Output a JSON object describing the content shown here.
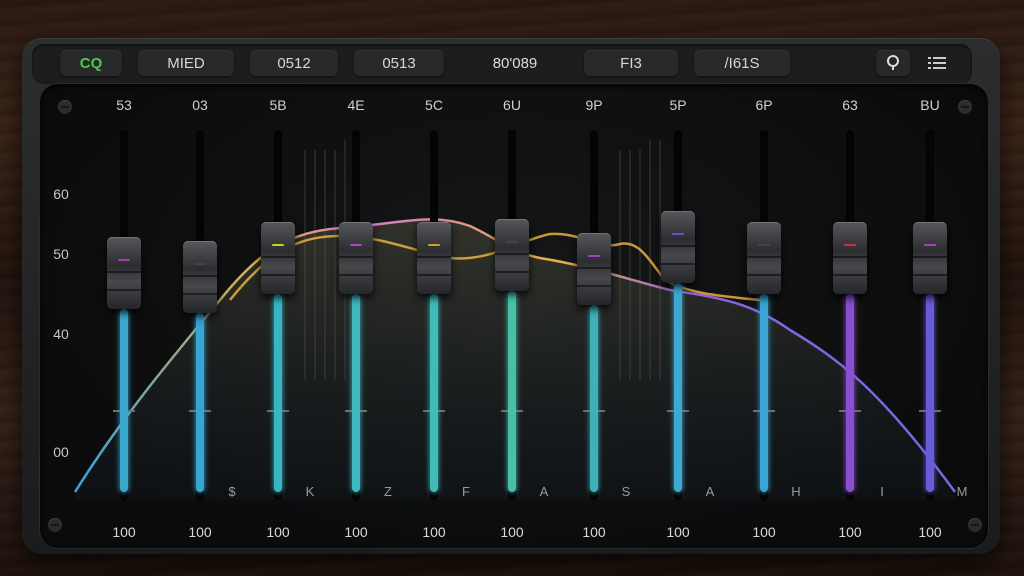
{
  "toolbar": {
    "logo": "CQ",
    "preset": "MIED",
    "field_a": "0512",
    "field_b": "0513",
    "readout": "80'089",
    "mode": "FI3",
    "field_c": "/I61S"
  },
  "y_axis_labels": [
    "60",
    "50",
    "40",
    "00"
  ],
  "bands": [
    {
      "freq": "53",
      "glyph": "",
      "value": "100",
      "level": 0.37,
      "fill_color": "#3aa8cc",
      "knob_line": "#b23aa8"
    },
    {
      "freq": "03",
      "glyph": "$",
      "value": "100",
      "level": 0.36,
      "fill_color": "#37a6d2",
      "knob_line": "#444"
    },
    {
      "freq": "5B",
      "glyph": "K",
      "value": "100",
      "level": 0.41,
      "fill_color": "#38b4c2",
      "knob_line": "#c8d020"
    },
    {
      "freq": "4E",
      "glyph": "Z",
      "value": "100",
      "level": 0.41,
      "fill_color": "#3fb8c0",
      "knob_line": "#c040c0"
    },
    {
      "freq": "5C",
      "glyph": "F",
      "value": "100",
      "level": 0.41,
      "fill_color": "#3fbcb8",
      "knob_line": "#d0a020"
    },
    {
      "freq": "6U",
      "glyph": "A",
      "value": "100",
      "level": 0.42,
      "fill_color": "#48c0a8",
      "knob_line": "#444"
    },
    {
      "freq": "9P",
      "glyph": "S",
      "value": "100",
      "level": 0.38,
      "fill_color": "#3eb0b8",
      "knob_line": "#a040d0"
    },
    {
      "freq": "5P",
      "glyph": "A",
      "value": "100",
      "level": 0.44,
      "fill_color": "#40a8d0",
      "knob_line": "#7050d0"
    },
    {
      "freq": "6P",
      "glyph": "H",
      "value": "100",
      "level": 0.41,
      "fill_color": "#3aa4d4",
      "knob_line": "#444"
    },
    {
      "freq": "63",
      "glyph": "I",
      "value": "100",
      "level": 0.41,
      "fill_color": "#8a4ed0",
      "knob_line": "#d03040"
    },
    {
      "freq": "BU",
      "glyph": "M",
      "value": "100",
      "level": 0.41,
      "fill_color": "#6a5cd8",
      "knob_line": "#b040c0"
    }
  ],
  "colors": {
    "accent_green": "#4cc850",
    "curve_gold": "#e8b040",
    "curve_violet": "#9060e0"
  }
}
